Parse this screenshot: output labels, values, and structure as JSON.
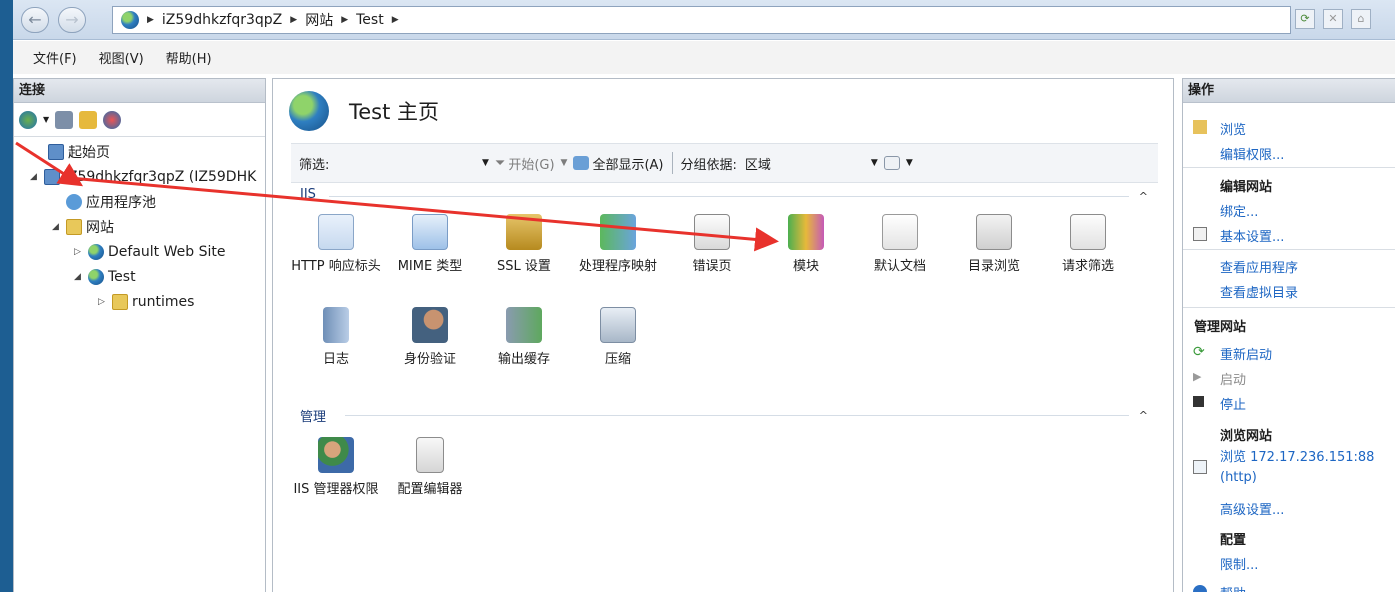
{
  "address": {
    "crumbs": [
      "iZ59dhkzfqr3qpZ",
      "网站",
      "Test"
    ]
  },
  "menu": [
    "文件(F)",
    "视图(V)",
    "帮助(H)"
  ],
  "connections": {
    "title": "连接",
    "tree": [
      {
        "label": "起始页",
        "icon": "start-page-icon"
      },
      {
        "label": "iZ59dhkzfqr3qpZ (IZ59DHK",
        "icon": "server-icon"
      },
      {
        "label": "应用程序池",
        "icon": "app-pool-icon"
      },
      {
        "label": "网站",
        "icon": "folder-icon"
      },
      {
        "label": "Default Web Site",
        "icon": "globe-icon"
      },
      {
        "label": "Test",
        "icon": "globe-icon"
      },
      {
        "label": "runtimes",
        "icon": "folder-icon"
      }
    ]
  },
  "center": {
    "title": "Test 主页",
    "filter": {
      "label": "筛选:",
      "start": "开始(G)",
      "show_all": "全部显示(A)",
      "group_by_label": "分组依据:",
      "group_by_value": "区域"
    },
    "groups": [
      {
        "name": "IIS",
        "features": [
          {
            "label": "HTTP 响应标头",
            "icon": "http-response-headers-icon"
          },
          {
            "label": "MIME 类型",
            "icon": "mime-types-icon"
          },
          {
            "label": "SSL 设置",
            "icon": "ssl-lock-icon"
          },
          {
            "label": "处理程序映射",
            "icon": "handler-mappings-icon"
          },
          {
            "label": "错误页",
            "icon": "error-pages-icon"
          },
          {
            "label": "模块",
            "icon": "modules-icon"
          },
          {
            "label": "默认文档",
            "icon": "default-document-icon"
          },
          {
            "label": "目录浏览",
            "icon": "directory-browsing-icon"
          },
          {
            "label": "请求筛选",
            "icon": "request-filtering-icon"
          },
          {
            "label": "日志",
            "icon": "logging-icon"
          },
          {
            "label": "身份验证",
            "icon": "authentication-icon"
          },
          {
            "label": "输出缓存",
            "icon": "output-caching-icon"
          },
          {
            "label": "压缩",
            "icon": "compression-icon"
          }
        ]
      },
      {
        "name": "管理",
        "features": [
          {
            "label": "IIS 管理器权限",
            "icon": "iis-manager-permissions-icon"
          },
          {
            "label": "配置编辑器",
            "icon": "configuration-editor-icon"
          }
        ]
      }
    ]
  },
  "actions": {
    "title": "操作",
    "browse": "浏览",
    "edit_permissions": "编辑权限...",
    "edit_site_header": "编辑网站",
    "bindings": "绑定...",
    "basic_settings": "基本设置...",
    "view_apps": "查看应用程序",
    "view_vdirs": "查看虚拟目录",
    "manage_site_header": "管理网站",
    "restart": "重新启动",
    "start": "启动",
    "stop": "停止",
    "browse_site_header": "浏览网站",
    "browse_addr": "浏览 172.17.236.151:88",
    "browse_proto": "(http)",
    "advanced_settings": "高级设置...",
    "config_header": "配置",
    "limits": "限制...",
    "help": "帮助"
  },
  "colors": {
    "link": "#1d66c3",
    "annotation_arrow": "#e8322c"
  }
}
